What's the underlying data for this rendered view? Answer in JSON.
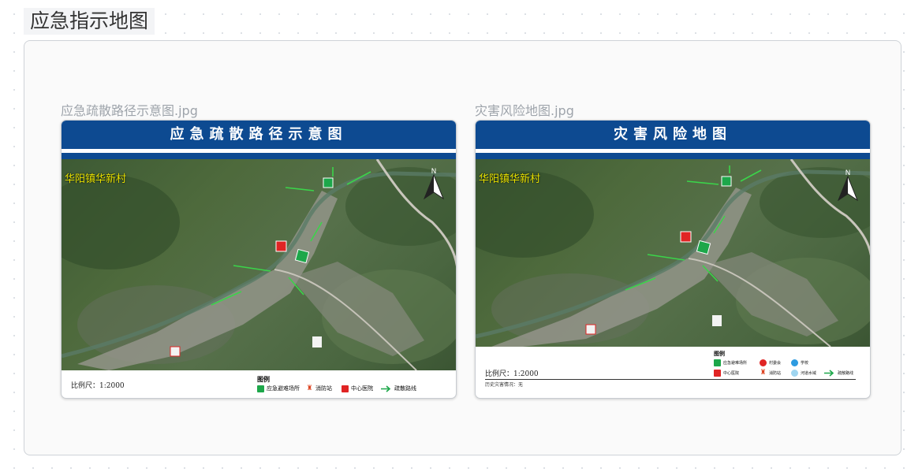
{
  "page": {
    "title": "应急指示地图"
  },
  "cards": [
    {
      "filename": "应急疏散路径示意图.jpg",
      "header": "应急疏散路径示意图",
      "village": "华阳镇华新村",
      "north": "N",
      "scale": "比例尺：1:2000",
      "legend_title": "图例",
      "legend": [
        {
          "label": "应急避难场所",
          "icon": "shelter-icon"
        },
        {
          "label": "消防站",
          "icon": "fire-station-icon"
        },
        {
          "label": "中心医院",
          "icon": "hospital-icon"
        },
        {
          "label": "疏散路线",
          "icon": "arrow-icon"
        }
      ]
    },
    {
      "filename": "灾害风险地图.jpg",
      "header": "灾害风险地图",
      "village": "华阳镇华新村",
      "north": "N",
      "scale": "比例尺：1:2000",
      "note": "历史灾害情况：无",
      "legend_title": "图例",
      "legend": [
        {
          "label": "应急避难场所",
          "icon": "shelter-icon"
        },
        {
          "label": "村委会",
          "icon": "village-committee-icon"
        },
        {
          "label": "学校",
          "icon": "school-icon"
        },
        {
          "label": "中心医院",
          "icon": "hospital-icon"
        },
        {
          "label": "消防站",
          "icon": "fire-station-icon"
        },
        {
          "label": "河道水域",
          "icon": "water-icon"
        },
        {
          "label": "疏散路线",
          "icon": "arrow-icon"
        }
      ]
    }
  ],
  "colors": {
    "header_blue": "#0d4a91",
    "village_yellow": "#e8e100",
    "route_green": "#3bd44a"
  }
}
